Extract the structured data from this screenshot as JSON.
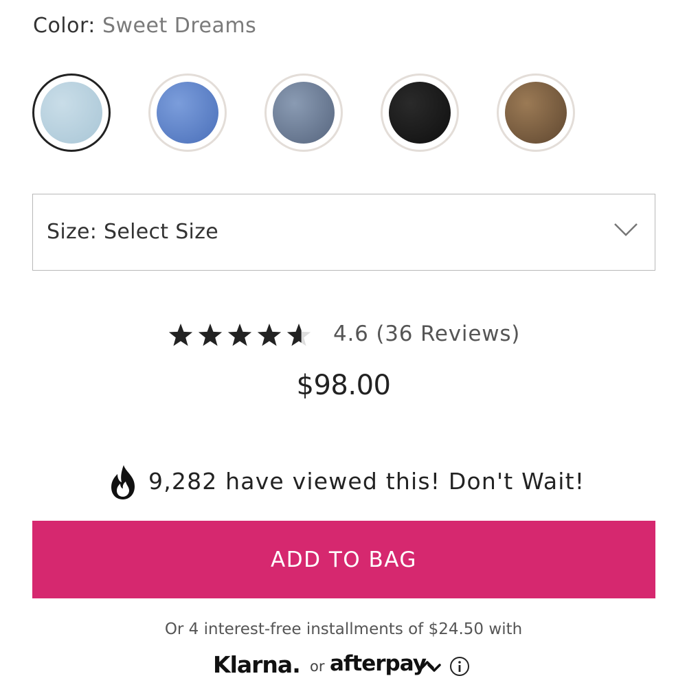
{
  "color": {
    "label": "Color:",
    "selected_value": "Sweet Dreams",
    "swatches": [
      {
        "name": "light-wash-denim",
        "colors": [
          "#c9dde8",
          "#a9c6d6"
        ],
        "selected": true
      },
      {
        "name": "medium-blue-denim",
        "colors": [
          "#7b9ddb",
          "#4a6fb9"
        ],
        "selected": false
      },
      {
        "name": "gray-blue-denim",
        "colors": [
          "#8a9bb3",
          "#56657e"
        ],
        "selected": false
      },
      {
        "name": "black-denim",
        "colors": [
          "#2a2a2a",
          "#0f0f0f"
        ],
        "selected": false
      },
      {
        "name": "brown-denim",
        "colors": [
          "#9b7a55",
          "#5f4730"
        ],
        "selected": false
      }
    ]
  },
  "size": {
    "label": "Size: Select Size"
  },
  "rating": {
    "value": 4.6,
    "max": 5,
    "text": "4.6 (36 Reviews)",
    "star_color": "#222222",
    "empty_star_color": "#dddddd"
  },
  "price": "$98.00",
  "views": {
    "icon": "flame-icon",
    "text": "9,282 have viewed this! Don't Wait!"
  },
  "add_to_bag": {
    "label": "ADD TO BAG",
    "color": "#d6286f"
  },
  "installments": {
    "text": "Or 4 interest-free installments of $24.50 with",
    "klarna": "Klarna.",
    "or": "or",
    "afterpay": "afterpay"
  }
}
